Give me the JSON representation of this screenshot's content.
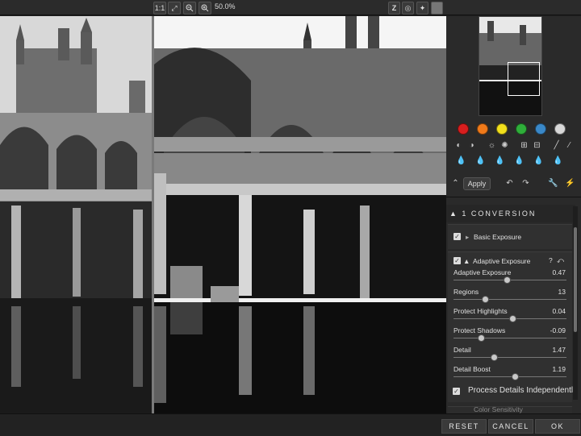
{
  "toolbar": {
    "one_to_one": "1:1",
    "zoom_level": "50.0%"
  },
  "panel": {
    "apply_label": "Apply",
    "conversion_title": "▲ 1  CONVERSION",
    "basic_exposure": "Basic Exposure",
    "adaptive_exposure_title": "Adaptive Exposure",
    "help_mark": "?",
    "sliders": [
      {
        "label": "Adaptive Exposure",
        "value": "0.47",
        "level": 0.47
      },
      {
        "label": "Regions",
        "value": "13",
        "level": 0.28
      },
      {
        "label": "Protect Highlights",
        "value": "0.04",
        "level": 0.52
      },
      {
        "label": "Protect Shadows",
        "value": "-0.09",
        "level": 0.24
      },
      {
        "label": "Detail",
        "value": "1.47",
        "level": 0.36
      },
      {
        "label": "Detail Boost",
        "value": "1.19",
        "level": 0.54
      }
    ],
    "process_details": "Process Details Independently",
    "color_sensitivity": "Color Sensitivity",
    "swatches": [
      "#d81e1e",
      "#f07a1a",
      "#f2e01c",
      "#2fae3a",
      "#3a88c8",
      "#d8d8d8"
    ]
  },
  "bottom": {
    "reset": "RESET",
    "cancel": "CANCEL",
    "ok": "OK"
  }
}
